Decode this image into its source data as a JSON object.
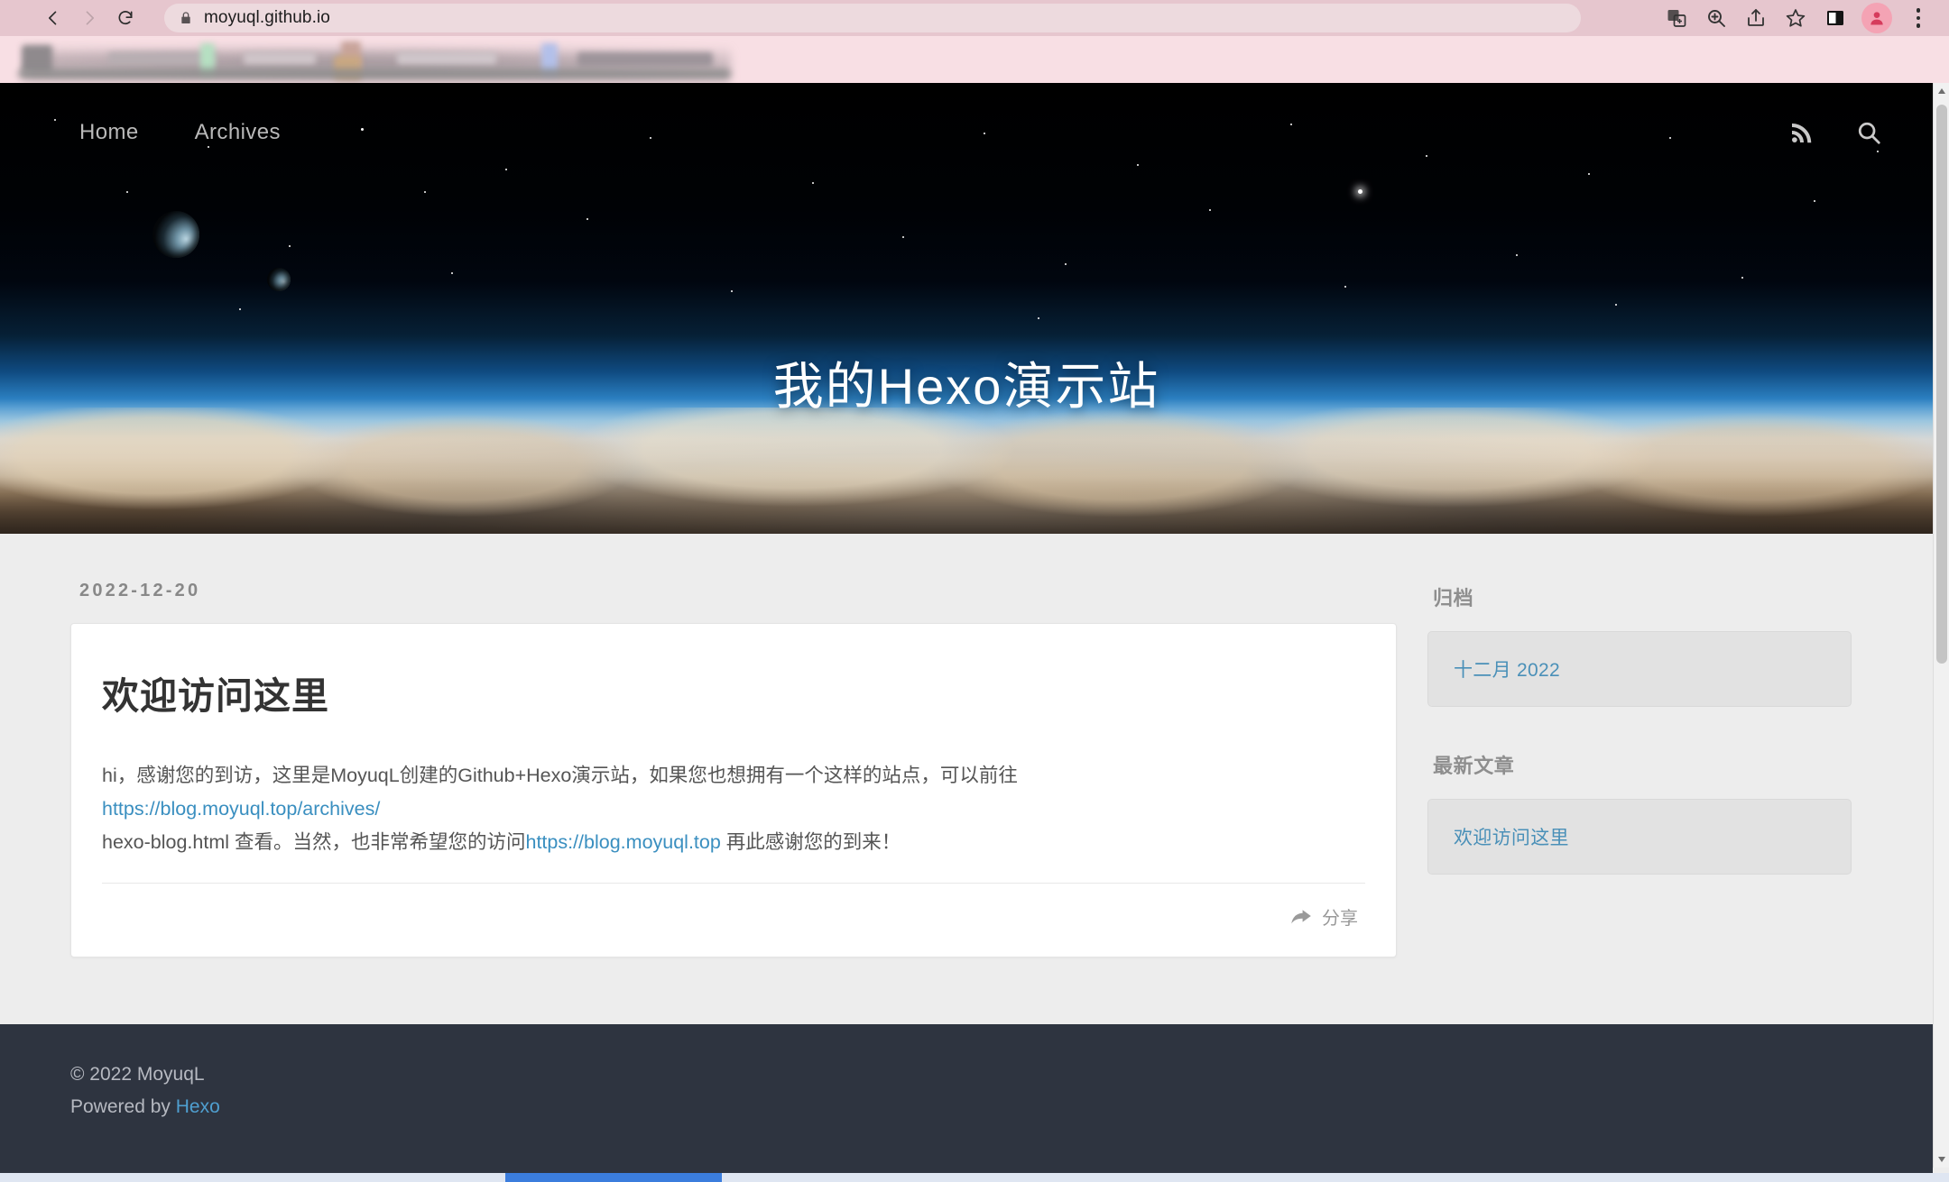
{
  "browser": {
    "url": "moyuql.github.io",
    "nav_icons": [
      "back-arrow",
      "forward-arrow",
      "reload"
    ],
    "toolbar_icons": [
      "translate-icon",
      "zoom-icon",
      "share-icon",
      "bookmark-star-icon",
      "side-panel-icon",
      "profile-avatar-icon",
      "three-dot-menu-icon"
    ],
    "lock_icon": "lock-icon"
  },
  "site": {
    "nav": {
      "links": [
        {
          "label": "Home"
        },
        {
          "label": "Archives"
        }
      ],
      "rss_icon": "rss-icon",
      "search_icon": "search-icon"
    },
    "hero_title": "我的Hexo演示站"
  },
  "post": {
    "date": "2022-12-20",
    "title": "欢迎访问这里",
    "body": {
      "line1_before": "hi，感谢您的到访，这里是MoyuqL创建的Github+Hexo演示站，如果您也想拥有一个这样的站点，可以前往",
      "link1": "https://blog.moyuql.top/archives/",
      "line2_mid": "hexo-blog.html 查看。当然，也非常希望您的访问",
      "link2": "https://blog.moyuql.top",
      "line2_after": " 再此感谢您的到来！"
    },
    "share_label": "分享",
    "share_icon": "share-arrow-icon"
  },
  "sidebar": {
    "sections": [
      {
        "heading": "归档",
        "items": [
          {
            "label": "十二月 2022"
          }
        ]
      },
      {
        "heading": "最新文章",
        "items": [
          {
            "label": "欢迎访问这里"
          }
        ]
      }
    ]
  },
  "footer": {
    "copyright": "© 2022 MoyuqL",
    "powered_prefix": "Powered by ",
    "powered_link": "Hexo"
  },
  "colors": {
    "link": "#3a8fc0",
    "sidebar_link": "#4a90b8",
    "footer_bg": "#2e3440",
    "content_bg": "#ededed",
    "chrome_bg": "#e6c6ce"
  }
}
